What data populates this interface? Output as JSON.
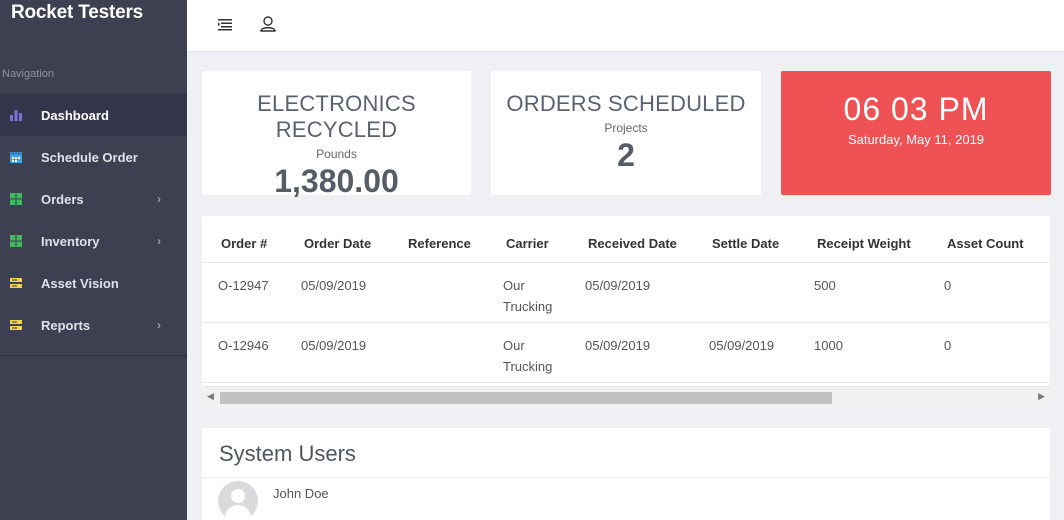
{
  "sidebar": {
    "brand": "Rocket Testers",
    "nav_heading": "Navigation",
    "items": [
      {
        "label": "Dashboard",
        "icon": "bar-chart-icon",
        "active": true
      },
      {
        "label": "Schedule Order",
        "icon": "calendar-icon"
      },
      {
        "label": "Orders",
        "icon": "grid-icon",
        "chevron": true
      },
      {
        "label": "Inventory",
        "icon": "grid-icon",
        "chevron": true
      },
      {
        "label": "Asset Vision",
        "icon": "server-icon"
      },
      {
        "label": "Reports",
        "icon": "server-icon",
        "chevron": true
      }
    ]
  },
  "topbar": {
    "icons": [
      "menu-icon",
      "user-icon"
    ]
  },
  "cards": {
    "electronics": {
      "title": "ELECTRONICS RECYCLED",
      "sub": "Pounds",
      "value": "1,380.00"
    },
    "orders": {
      "title": "ORDERS SCHEDULED",
      "sub": "Projects",
      "value": "2"
    },
    "clock": {
      "time": "06 03 PM",
      "date": "Saturday, May 11, 2019"
    }
  },
  "table": {
    "headers": [
      "Order #",
      "Order Date",
      "Reference",
      "Carrier",
      "Received Date",
      "Settle Date",
      "Receipt Weight",
      "Asset Count"
    ],
    "rows": [
      [
        "O-12947",
        "05/09/2019",
        "",
        "Our Trucking",
        "05/09/2019",
        "",
        "500",
        "0"
      ],
      [
        "O-12946",
        "05/09/2019",
        "",
        "Our Trucking",
        "05/09/2019",
        "05/09/2019",
        "1000",
        "0"
      ]
    ]
  },
  "users": {
    "title": "System Users",
    "list": [
      {
        "name": "John Doe"
      }
    ]
  },
  "colors": {
    "sidebar_bg": "#3d4050",
    "clock_bg": "#ef5254",
    "icon_purple": "#7c6fd6",
    "icon_blue": "#4aa3df",
    "icon_green": "#3fb85f",
    "icon_yellow": "#f2d34d"
  }
}
